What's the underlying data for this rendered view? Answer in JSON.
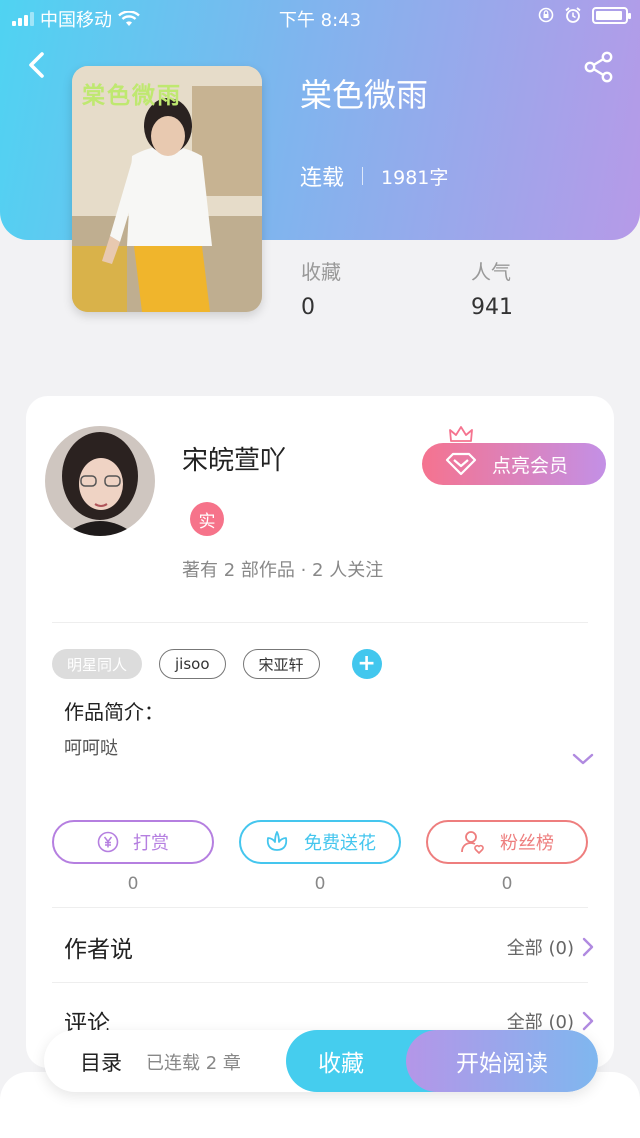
{
  "status_bar": {
    "carrier": "中国移动",
    "time": "下午 8:43"
  },
  "book": {
    "cover_title": "棠色微雨",
    "title": "棠色微雨",
    "status": "连载",
    "word_count": "1981字",
    "favorites_label": "收藏",
    "favorites_value": "0",
    "popularity_label": "人气",
    "popularity_value": "941"
  },
  "author": {
    "name": "宋皖萱吖",
    "verified_badge": "实",
    "stats": "著有 2 部作品 · 2 人关注",
    "vip_button": "点亮会员"
  },
  "tags": [
    "明星同人",
    "jisoo",
    "宋亚轩"
  ],
  "intro": {
    "title": "作品简介：",
    "text": "呵呵哒"
  },
  "actions": [
    {
      "label": "打赏",
      "count": "0",
      "color": "#b57fe0"
    },
    {
      "label": "免费送花",
      "count": "0",
      "color": "#45c6ee"
    },
    {
      "label": "粉丝榜",
      "count": "0",
      "color": "#ee7e7e"
    }
  ],
  "sections": [
    {
      "title": "作者说",
      "more": "全部 (0)"
    },
    {
      "title": "评论",
      "more": "全部 (0)"
    }
  ],
  "bottom_bar": {
    "toc": "目录",
    "chapters": "已连载 2 章",
    "favorite": "收藏",
    "start_reading": "开始阅读"
  },
  "colors": {
    "accent_cyan": "#45cdee",
    "accent_purple": "#b496e8",
    "vip_pink": "#f5738f"
  }
}
